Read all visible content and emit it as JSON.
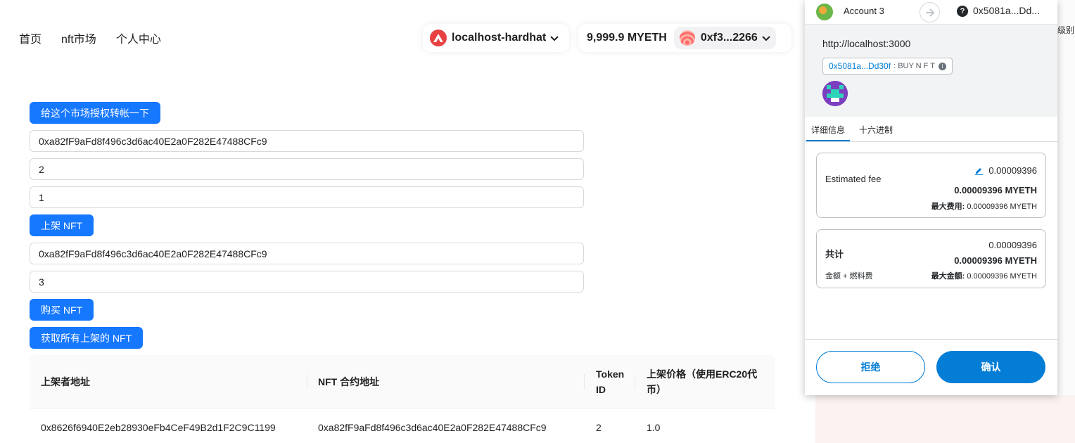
{
  "nav": {
    "home": "首页",
    "market": "nft市场",
    "profile": "个人中心"
  },
  "network": {
    "label": "localhost-hardhat",
    "icon": "avalanche-icon",
    "accent": "#e84142"
  },
  "account": {
    "balance": "9,999.9 MYETH",
    "address": "0xf3...2266"
  },
  "form": {
    "approve_label": "给这个市场授权转帐一下",
    "list_address": "0xa82fF9aFd8f496c3d6ac40E2a0F282E47488CFc9",
    "list_token_id": "2",
    "list_price": "1",
    "list_button": "上架 NFT",
    "buy_address": "0xa82fF9aFd8f496c3d6ac40E2a0F282E47488CFc9",
    "buy_token_id": "3",
    "buy_button": "购买 NFT",
    "fetch_button": "获取所有上架的 NFT",
    "accent": "#1677ff"
  },
  "table": {
    "headers": [
      "上架者地址",
      "NFT 合约地址",
      "Token ID",
      "上架价格（使用ERC20代币）"
    ],
    "rows": [
      [
        "0x8626f6940E2eb28930eFb4CeF49B2d1F2C9C1199",
        "0xa82fF9aFd8f496c3d6ac40E2a0F282E47488CFc9",
        "2",
        "1.0"
      ]
    ]
  },
  "metamask": {
    "account_name": "Account 3",
    "to_address": "0x5081a...Dd...",
    "origin": "http://localhost:3000",
    "contract_address": "0x5081a...Dd30f",
    "method": ": BUY N F T",
    "tab_details": "详细信息",
    "tab_hex": "十六进制",
    "fee": {
      "label": "Estimated fee",
      "amount": "0.00009396",
      "amount_bold": "0.00009396 MYETH",
      "max_label": "最大费用:",
      "max_value": "0.00009396 MYETH"
    },
    "total": {
      "label": "共计",
      "amount": "0.00009396",
      "amount_bold": "0.00009396 MYETH",
      "sub_label": "金额 + 燃料费",
      "max_label": "最大金额:",
      "max_value": "0.00009396 MYETH"
    },
    "reject": "拒绝",
    "confirm": "确认",
    "accent": "#037dd6"
  },
  "side_label": "级别"
}
